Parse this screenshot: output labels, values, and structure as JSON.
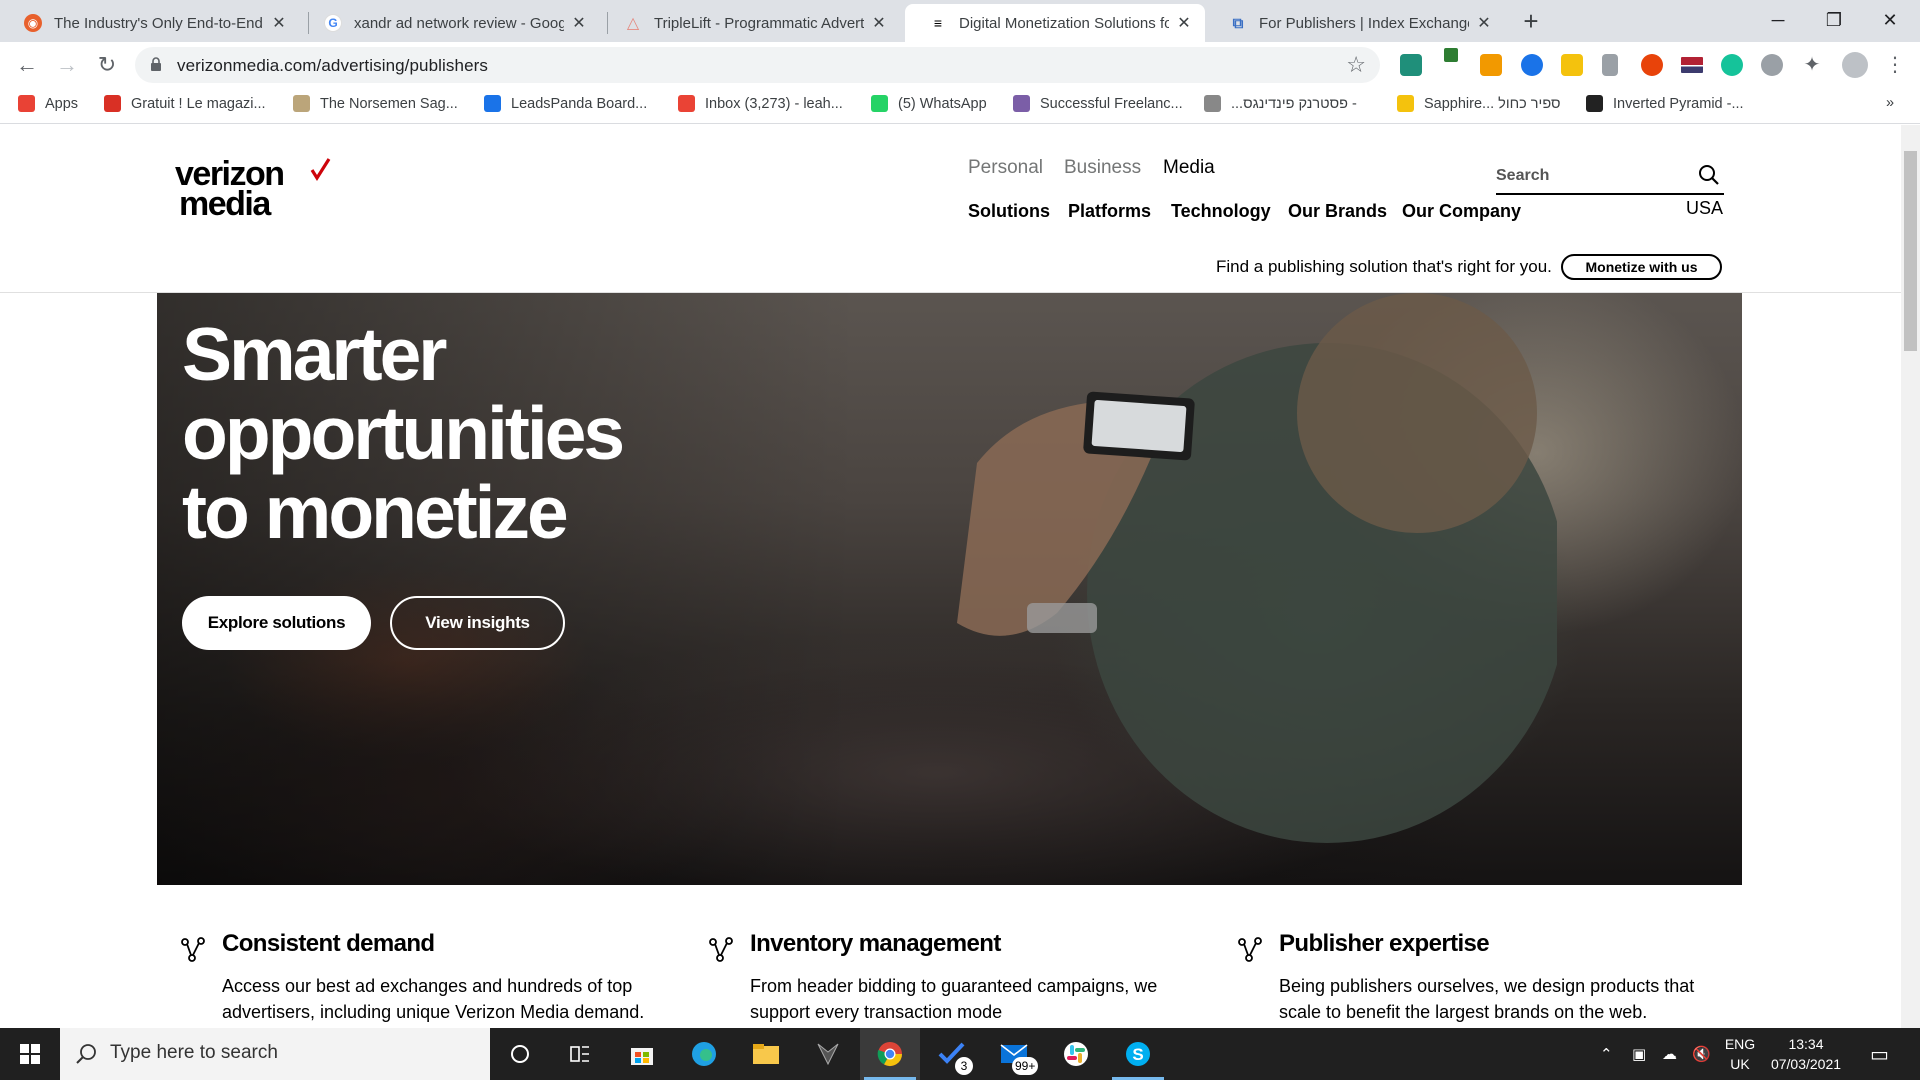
{
  "browser": {
    "tabs": [
      {
        "title": "The Industry's Only End-to-End I",
        "active": false,
        "favicon_color": "#e8602c"
      },
      {
        "title": "xandr ad network review - Googl",
        "active": false,
        "favicon_color": "#4285f4"
      },
      {
        "title": "TripleLift - Programmatic Adverti",
        "active": false,
        "favicon_color": "#e48a80"
      },
      {
        "title": "Digital Monetization Solutions fo",
        "active": true,
        "favicon_color": "#000000"
      },
      {
        "title": "For Publishers | Index Exchange",
        "active": false,
        "favicon_color": "#3a6fc4"
      }
    ],
    "url": "verizonmedia.com/advertising/publishers",
    "bookmarks": [
      {
        "label": "Apps",
        "icon": "apps-grid-icon",
        "color": "#e94235"
      },
      {
        "label": "Gratuit ! Le magazi...",
        "icon": "bookmark-red-icon",
        "color": "#d93025"
      },
      {
        "label": "The Norsemen Sag...",
        "icon": "goodreads-icon",
        "color": "#bba57a"
      },
      {
        "label": "LeadsPanda Board...",
        "icon": "leadspanda-icon",
        "color": "#1a73e8"
      },
      {
        "label": "Inbox (3,273) - leah...",
        "icon": "gmail-icon",
        "color": "#ea4335"
      },
      {
        "label": "(5) WhatsApp",
        "icon": "whatsapp-icon",
        "color": "#25d366"
      },
      {
        "label": "Successful Freelanc...",
        "icon": "freelancer-icon",
        "color": "#7b5ea7"
      },
      {
        "label": "...פסטרנק פינדינגס -",
        "icon": "bookmark-gray-icon",
        "color": "#888888"
      },
      {
        "label": "Sapphire... ספיר כחול",
        "icon": "heart-icon",
        "color": "#f4c20d"
      },
      {
        "label": "Inverted Pyramid -...",
        "icon": "w-icon",
        "color": "#222222"
      }
    ]
  },
  "site": {
    "logo_line1": "verizon",
    "logo_line2": "media",
    "top_nav": [
      {
        "label": "Personal",
        "active": false
      },
      {
        "label": "Business",
        "active": false
      },
      {
        "label": "Media",
        "active": true
      }
    ],
    "main_nav": [
      "Solutions",
      "Platforms",
      "Technology",
      "Our Brands",
      "Our Company"
    ],
    "search_placeholder": "Search",
    "region": "USA",
    "tagline": "Find a publishing solution that's right for you.",
    "monetize_label": "Monetize with us",
    "accent_color": "#cd040b"
  },
  "hero": {
    "title_lines": [
      "Smarter",
      "opportunities",
      "to monetize"
    ],
    "primary_cta": "Explore solutions",
    "secondary_cta": "View insights"
  },
  "features": [
    {
      "title": "Consistent demand",
      "text": "Access our best ad exchanges and hundreds of top advertisers, including unique Verizon Media demand."
    },
    {
      "title": "Inventory management",
      "text": "From header bidding to guaranteed campaigns, we support every transaction mode"
    },
    {
      "title": "Publisher expertise",
      "text": "Being publishers ourselves, we design products that scale to benefit the largest brands on the web."
    }
  ],
  "taskbar": {
    "search_placeholder": "Type here to search",
    "lang_line1": "ENG",
    "lang_line2": "UK",
    "time": "13:34",
    "date": "07/03/2021",
    "todo_badge": "3",
    "mail_badge": "99+"
  }
}
